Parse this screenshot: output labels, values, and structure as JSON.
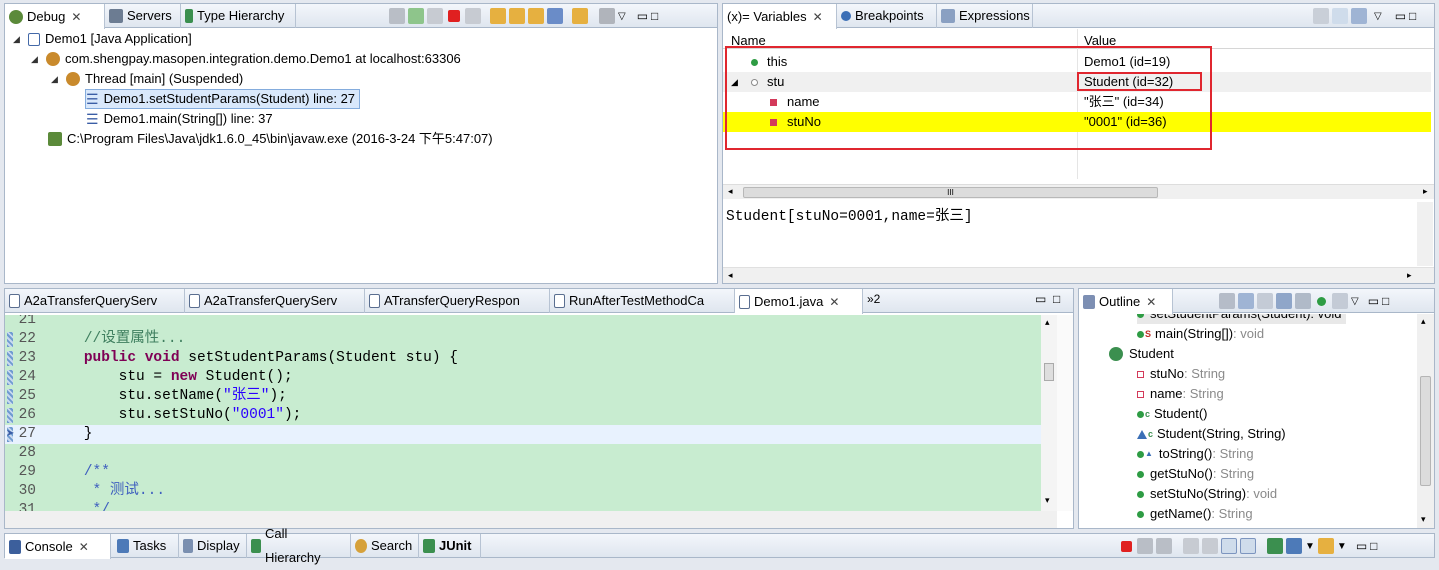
{
  "debug_view": {
    "tabs": [
      {
        "label": "Debug",
        "close": "✕"
      },
      {
        "label": "Servers"
      },
      {
        "label": "Type Hierarchy"
      }
    ],
    "tree": [
      "Demo1 [Java Application]",
      "com.shengpay.masopen.integration.demo.Demo1 at localhost:63306",
      "Thread [main] (Suspended)",
      "Demo1.setStudentParams(Student) line: 27",
      "Demo1.main(String[]) line: 37",
      "C:\\Program Files\\Java\\jdk1.6.0_45\\bin\\javaw.exe (2016-3-24 下午5:47:07)"
    ]
  },
  "variables_view": {
    "tabs": [
      {
        "label": "(x)= Variables",
        "close": "✕"
      },
      {
        "label": "Breakpoints"
      },
      {
        "label": "Expressions"
      }
    ],
    "columns": [
      "Name",
      "Value"
    ],
    "rows": [
      {
        "name": "this",
        "value": "Demo1  (id=19)"
      },
      {
        "name": "stu",
        "value": "Student  (id=32)"
      },
      {
        "name": "name",
        "value": "\"张三\" (id=34)"
      },
      {
        "name": "stuNo",
        "value": "\"0001\" (id=36)"
      }
    ],
    "detail": "Student[stuNo=0001,name=张三]",
    "scroll_grip": "III"
  },
  "editor": {
    "tabs": [
      "A2aTransferQueryServ",
      "A2aTransferQueryServ",
      "ATransferQueryRespon",
      "RunAfterTestMethodCa",
      "Demo1.java"
    ],
    "overflow": "»2",
    "close": "✕",
    "lines": [
      {
        "n": "21",
        "segs": [
          {
            "t": ""
          }
        ]
      },
      {
        "n": "22",
        "segs": [
          {
            "t": "    "
          },
          {
            "t": "//设置属性...",
            "c": "comment"
          }
        ]
      },
      {
        "n": "23",
        "segs": [
          {
            "t": "    "
          },
          {
            "t": "public",
            "c": "kw"
          },
          {
            "t": " "
          },
          {
            "t": "void",
            "c": "kw"
          },
          {
            "t": " setStudentParams(Student stu) {"
          }
        ]
      },
      {
        "n": "24",
        "segs": [
          {
            "t": "        stu = "
          },
          {
            "t": "new",
            "c": "kw"
          },
          {
            "t": " Student();"
          }
        ]
      },
      {
        "n": "25",
        "segs": [
          {
            "t": "        stu.setName("
          },
          {
            "t": "\"张三\"",
            "c": "str"
          },
          {
            "t": ");"
          }
        ]
      },
      {
        "n": "26",
        "segs": [
          {
            "t": "        stu.setStuNo("
          },
          {
            "t": "\"0001\"",
            "c": "str"
          },
          {
            "t": ");"
          }
        ]
      },
      {
        "n": "27",
        "segs": [
          {
            "t": "    }"
          }
        ]
      },
      {
        "n": "28",
        "segs": [
          {
            "t": ""
          }
        ]
      },
      {
        "n": "29",
        "segs": [
          {
            "t": "    "
          },
          {
            "t": "/**",
            "c": "doc"
          }
        ]
      },
      {
        "n": "30",
        "segs": [
          {
            "t": "     "
          },
          {
            "t": "* 测试...",
            "c": "doc"
          }
        ]
      },
      {
        "n": "31",
        "segs": [
          {
            "t": "     "
          },
          {
            "t": "*/",
            "c": "doc"
          }
        ]
      }
    ]
  },
  "outline": {
    "tab": "Outline",
    "close": "✕",
    "items": [
      {
        "label": "setStudentParams(Student)",
        "type": " : void",
        "indent": 1,
        "icon": "method-public"
      },
      {
        "label": "main(String[])",
        "type": " : void",
        "indent": 1,
        "icon": "method-static",
        "sup": "S"
      },
      {
        "label": "Student",
        "type": "",
        "indent": 0,
        "icon": "class"
      },
      {
        "label": "stuNo",
        "type": " : String",
        "indent": 1,
        "icon": "field-private"
      },
      {
        "label": "name",
        "type": " : String",
        "indent": 1,
        "icon": "field-private"
      },
      {
        "label": "Student()",
        "type": "",
        "indent": 1,
        "icon": "constructor",
        "sup": "c"
      },
      {
        "label": "Student(String, String)",
        "type": "",
        "indent": 1,
        "icon": "constructor-default",
        "sup": "c"
      },
      {
        "label": "toString()",
        "type": " : String",
        "indent": 1,
        "icon": "method-override"
      },
      {
        "label": "getStuNo()",
        "type": " : String",
        "indent": 1,
        "icon": "method-public"
      },
      {
        "label": "setStuNo(String)",
        "type": " : void",
        "indent": 1,
        "icon": "method-public"
      },
      {
        "label": "getName()",
        "type": " : String",
        "indent": 1,
        "icon": "method-public"
      }
    ]
  },
  "bottom": {
    "tabs": [
      {
        "label": "Console",
        "close": "✕"
      },
      {
        "label": "Tasks"
      },
      {
        "label": "Display"
      },
      {
        "label": "Call Hierarchy"
      },
      {
        "label": "Search"
      },
      {
        "label": "JUnit",
        "bold": true
      }
    ]
  },
  "colors": {
    "highlight": "#ffff00",
    "redbox": "#e0262f",
    "editorbg": "#c8ecd0",
    "currentline": "#e8f2fe",
    "keyword": "#7f0055",
    "string": "#2a00ff",
    "comment": "#3f7f5f",
    "doc": "#3f5fbf"
  }
}
